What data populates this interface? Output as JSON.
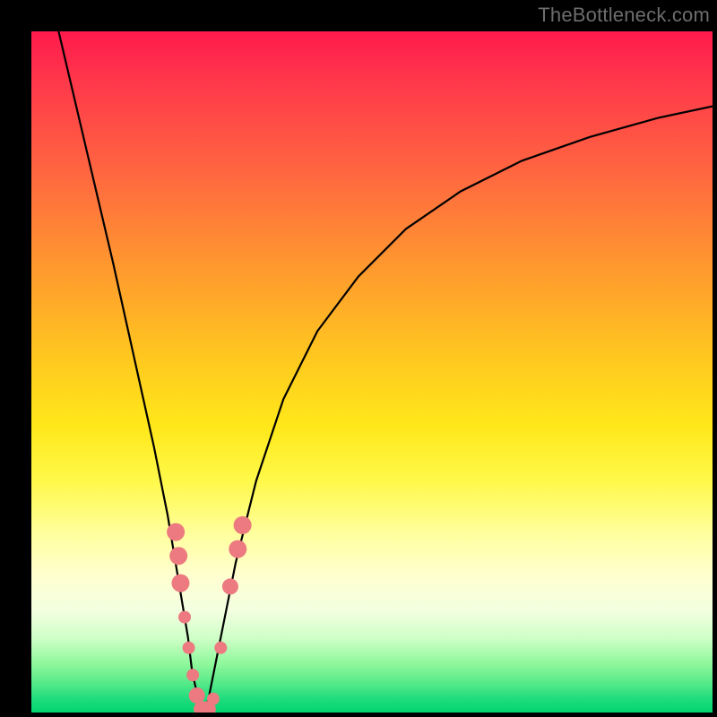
{
  "watermark": {
    "text": "TheBottleneck.com"
  },
  "chart_data": {
    "type": "line",
    "title": "",
    "xlabel": "",
    "ylabel": "",
    "xlim": [
      0,
      100
    ],
    "ylim": [
      0,
      100
    ],
    "grid": false,
    "legend": false,
    "series": [
      {
        "name": "bottleneck-curve",
        "x": [
          4,
          8,
          12,
          16,
          18,
          20,
          21,
          22,
          23,
          23.6,
          24.5,
          25.3,
          26,
          26.8,
          28,
          30,
          33,
          37,
          42,
          48,
          55,
          63,
          72,
          82,
          92,
          100
        ],
        "y": [
          100,
          83,
          66,
          48,
          39,
          29,
          23,
          17,
          11,
          6,
          2,
          0,
          2,
          6,
          12,
          22,
          34,
          46,
          56,
          64,
          71,
          76.5,
          81,
          84.5,
          87.3,
          89
        ]
      }
    ],
    "markers": [
      {
        "x": 21.2,
        "y": 26.5,
        "r": 10
      },
      {
        "x": 21.6,
        "y": 23,
        "r": 10
      },
      {
        "x": 21.9,
        "y": 19,
        "r": 10
      },
      {
        "x": 22.5,
        "y": 14,
        "r": 7
      },
      {
        "x": 23.1,
        "y": 9.5,
        "r": 7
      },
      {
        "x": 23.7,
        "y": 5.5,
        "r": 7
      },
      {
        "x": 24.3,
        "y": 2.5,
        "r": 9
      },
      {
        "x": 25.0,
        "y": 0.5,
        "r": 9
      },
      {
        "x": 25.9,
        "y": 0.5,
        "r": 9
      },
      {
        "x": 26.7,
        "y": 2.0,
        "r": 7
      },
      {
        "x": 27.8,
        "y": 9.5,
        "r": 7
      },
      {
        "x": 29.2,
        "y": 18.5,
        "r": 9
      },
      {
        "x": 30.3,
        "y": 24.0,
        "r": 10
      },
      {
        "x": 31.0,
        "y": 27.5,
        "r": 10
      }
    ],
    "gradient_stops": [
      {
        "pos": 0,
        "color": "#ff1a4d"
      },
      {
        "pos": 50,
        "color": "#ffe81a"
      },
      {
        "pos": 100,
        "color": "#02d471"
      }
    ]
  }
}
